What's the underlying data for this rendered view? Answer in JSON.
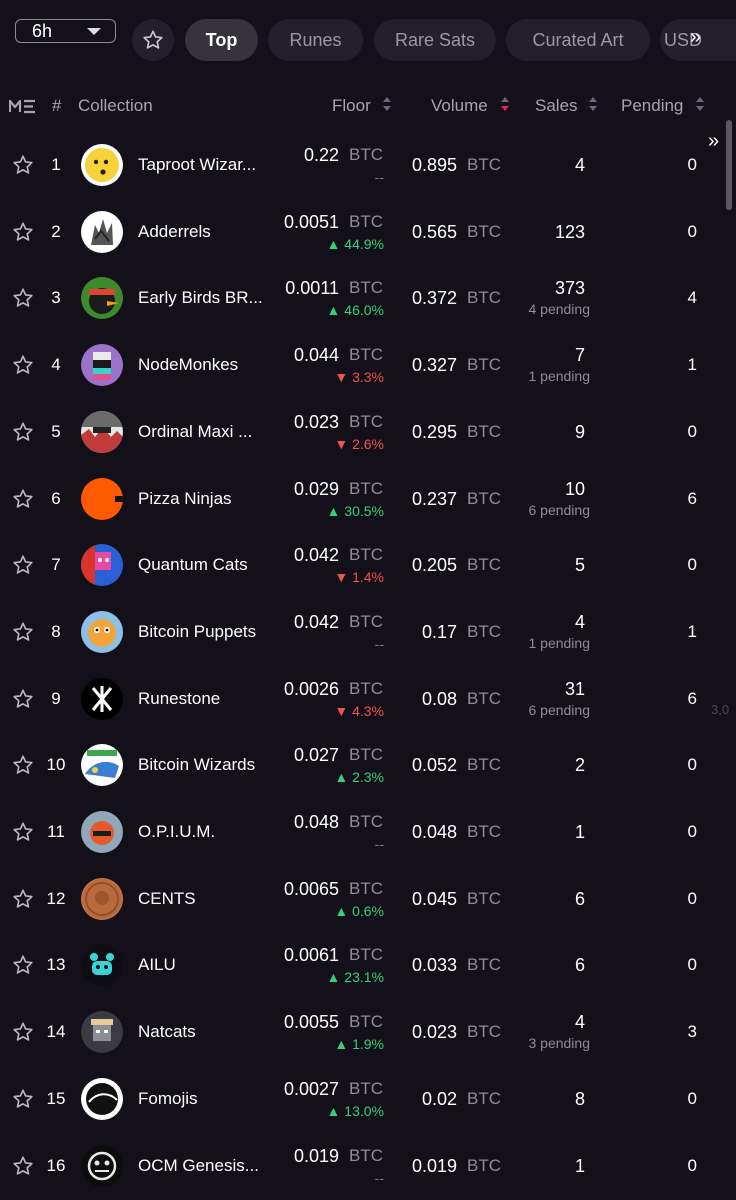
{
  "filters": {
    "period": "6h",
    "tabs": [
      "Top",
      "Runes",
      "Rare Sats",
      "Curated Art",
      "USD"
    ],
    "scroll_glyph": "»"
  },
  "header": {
    "rank": "#",
    "collection": "Collection",
    "floor": "Floor",
    "volume": "Volume",
    "sales": "Sales",
    "pending": "Pending"
  },
  "edge_text": {
    "row9": "3,0"
  },
  "colors": {
    "up": "#33d17a",
    "down": "#f0524f",
    "active_sort": "#e0245e",
    "background": "#141019"
  },
  "rows": [
    {
      "rank": "1",
      "name": "Taproot Wizar...",
      "floor": "0.22",
      "floor_unit": "BTC",
      "change": "--",
      "dir": "none",
      "volume": "0.895",
      "volume_unit": "BTC",
      "sales": "4",
      "sales_pending": "",
      "pending": "0",
      "avatar": "wizard"
    },
    {
      "rank": "2",
      "name": "Adderrels",
      "floor": "0.0051",
      "floor_unit": "BTC",
      "change": "44.9%",
      "dir": "up",
      "volume": "0.565",
      "volume_unit": "BTC",
      "sales": "123",
      "sales_pending": "",
      "pending": "0",
      "avatar": "adder"
    },
    {
      "rank": "3",
      "name": "Early Birds BR...",
      "floor": "0.0011",
      "floor_unit": "BTC",
      "change": "46.0%",
      "dir": "up",
      "volume": "0.372",
      "volume_unit": "BTC",
      "sales": "373",
      "sales_pending": "4 pending",
      "pending": "4",
      "avatar": "bird"
    },
    {
      "rank": "4",
      "name": "NodeMonkes",
      "floor": "0.044",
      "floor_unit": "BTC",
      "change": "3.3%",
      "dir": "down",
      "volume": "0.327",
      "volume_unit": "BTC",
      "sales": "7",
      "sales_pending": "1 pending",
      "pending": "1",
      "avatar": "monke"
    },
    {
      "rank": "5",
      "name": "Ordinal Maxi ...",
      "floor": "0.023",
      "floor_unit": "BTC",
      "change": "2.6%",
      "dir": "down",
      "volume": "0.295",
      "volume_unit": "BTC",
      "sales": "9",
      "sales_pending": "",
      "pending": "0",
      "avatar": "maxi"
    },
    {
      "rank": "6",
      "name": "Pizza Ninjas",
      "floor": "0.029",
      "floor_unit": "BTC",
      "change": "30.5%",
      "dir": "up",
      "volume": "0.237",
      "volume_unit": "BTC",
      "sales": "10",
      "sales_pending": "6 pending",
      "pending": "6",
      "avatar": "pizza"
    },
    {
      "rank": "7",
      "name": "Quantum Cats",
      "floor": "0.042",
      "floor_unit": "BTC",
      "change": "1.4%",
      "dir": "down",
      "volume": "0.205",
      "volume_unit": "BTC",
      "sales": "5",
      "sales_pending": "",
      "pending": "0",
      "avatar": "cats"
    },
    {
      "rank": "8",
      "name": "Bitcoin Puppets",
      "floor": "0.042",
      "floor_unit": "BTC",
      "change": "--",
      "dir": "none",
      "volume": "0.17",
      "volume_unit": "BTC",
      "sales": "4",
      "sales_pending": "1 pending",
      "pending": "1",
      "avatar": "puppet"
    },
    {
      "rank": "9",
      "name": "Runestone",
      "floor": "0.0026",
      "floor_unit": "BTC",
      "change": "4.3%",
      "dir": "down",
      "volume": "0.08",
      "volume_unit": "BTC",
      "sales": "31",
      "sales_pending": "6 pending",
      "pending": "6",
      "avatar": "rune"
    },
    {
      "rank": "10",
      "name": "Bitcoin Wizards",
      "floor": "0.027",
      "floor_unit": "BTC",
      "change": "2.3%",
      "dir": "up",
      "volume": "0.052",
      "volume_unit": "BTC",
      "sales": "2",
      "sales_pending": "",
      "pending": "0",
      "avatar": "bwiz"
    },
    {
      "rank": "11",
      "name": "O.P.I.U.M.",
      "floor": "0.048",
      "floor_unit": "BTC",
      "change": "--",
      "dir": "none",
      "volume": "0.048",
      "volume_unit": "BTC",
      "sales": "1",
      "sales_pending": "",
      "pending": "0",
      "avatar": "opium"
    },
    {
      "rank": "12",
      "name": "CENTS",
      "floor": "0.0065",
      "floor_unit": "BTC",
      "change": "0.6%",
      "dir": "up",
      "volume": "0.045",
      "volume_unit": "BTC",
      "sales": "6",
      "sales_pending": "",
      "pending": "0",
      "avatar": "cents"
    },
    {
      "rank": "13",
      "name": "AILU",
      "floor": "0.0061",
      "floor_unit": "BTC",
      "change": "23.1%",
      "dir": "up",
      "volume": "0.033",
      "volume_unit": "BTC",
      "sales": "6",
      "sales_pending": "",
      "pending": "0",
      "avatar": "ailu"
    },
    {
      "rank": "14",
      "name": "Natcats",
      "floor": "0.0055",
      "floor_unit": "BTC",
      "change": "1.9%",
      "dir": "up",
      "volume": "0.023",
      "volume_unit": "BTC",
      "sales": "4",
      "sales_pending": "3 pending",
      "pending": "3",
      "avatar": "natcat"
    },
    {
      "rank": "15",
      "name": "Fomojis",
      "floor": "0.0027",
      "floor_unit": "BTC",
      "change": "13.0%",
      "dir": "up",
      "volume": "0.02",
      "volume_unit": "BTC",
      "sales": "8",
      "sales_pending": "",
      "pending": "0",
      "avatar": "fomo"
    },
    {
      "rank": "16",
      "name": "OCM Genesis...",
      "floor": "0.019",
      "floor_unit": "BTC",
      "change": "--",
      "dir": "none",
      "volume": "0.019",
      "volume_unit": "BTC",
      "sales": "1",
      "sales_pending": "",
      "pending": "0",
      "avatar": "ocm"
    }
  ]
}
